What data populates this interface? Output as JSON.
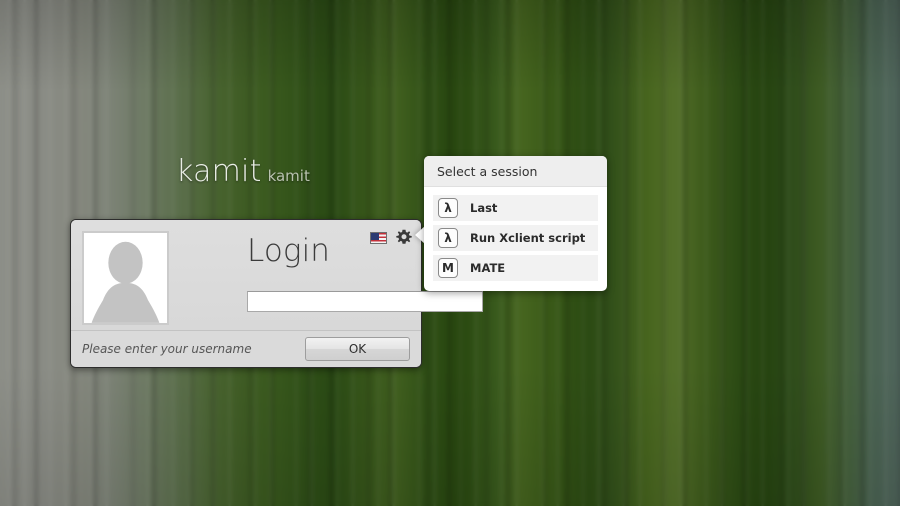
{
  "greeting": {
    "hostname": "kamit",
    "username": "kamit"
  },
  "login_panel": {
    "title": "Login",
    "avatar_icon": "default-user-avatar-icon",
    "username_value": "",
    "username_placeholder": "",
    "status_message": "Please enter your username",
    "ok_label": "OK",
    "language_icon": "us-flag-icon",
    "settings_icon": "gear-icon"
  },
  "session_popup": {
    "header": "Select a session",
    "items": [
      {
        "label": "Last",
        "icon": "lambda-session-icon",
        "glyph": "λ"
      },
      {
        "label": "Run Xclient script",
        "icon": "lambda-session-icon",
        "glyph": "λ"
      },
      {
        "label": "MATE",
        "icon": "mate-session-icon",
        "glyph": "M"
      }
    ]
  },
  "colors": {
    "panel_background": "#dcdcdc",
    "panel_border": "#2d2d2d",
    "popup_background": "#ffffff",
    "popup_header_background": "#eeeeee",
    "session_row_background": "#f2f2f2",
    "desktop_green": "#3c5222",
    "text_primary": "#2b2b2b",
    "status_text": "#565656"
  }
}
